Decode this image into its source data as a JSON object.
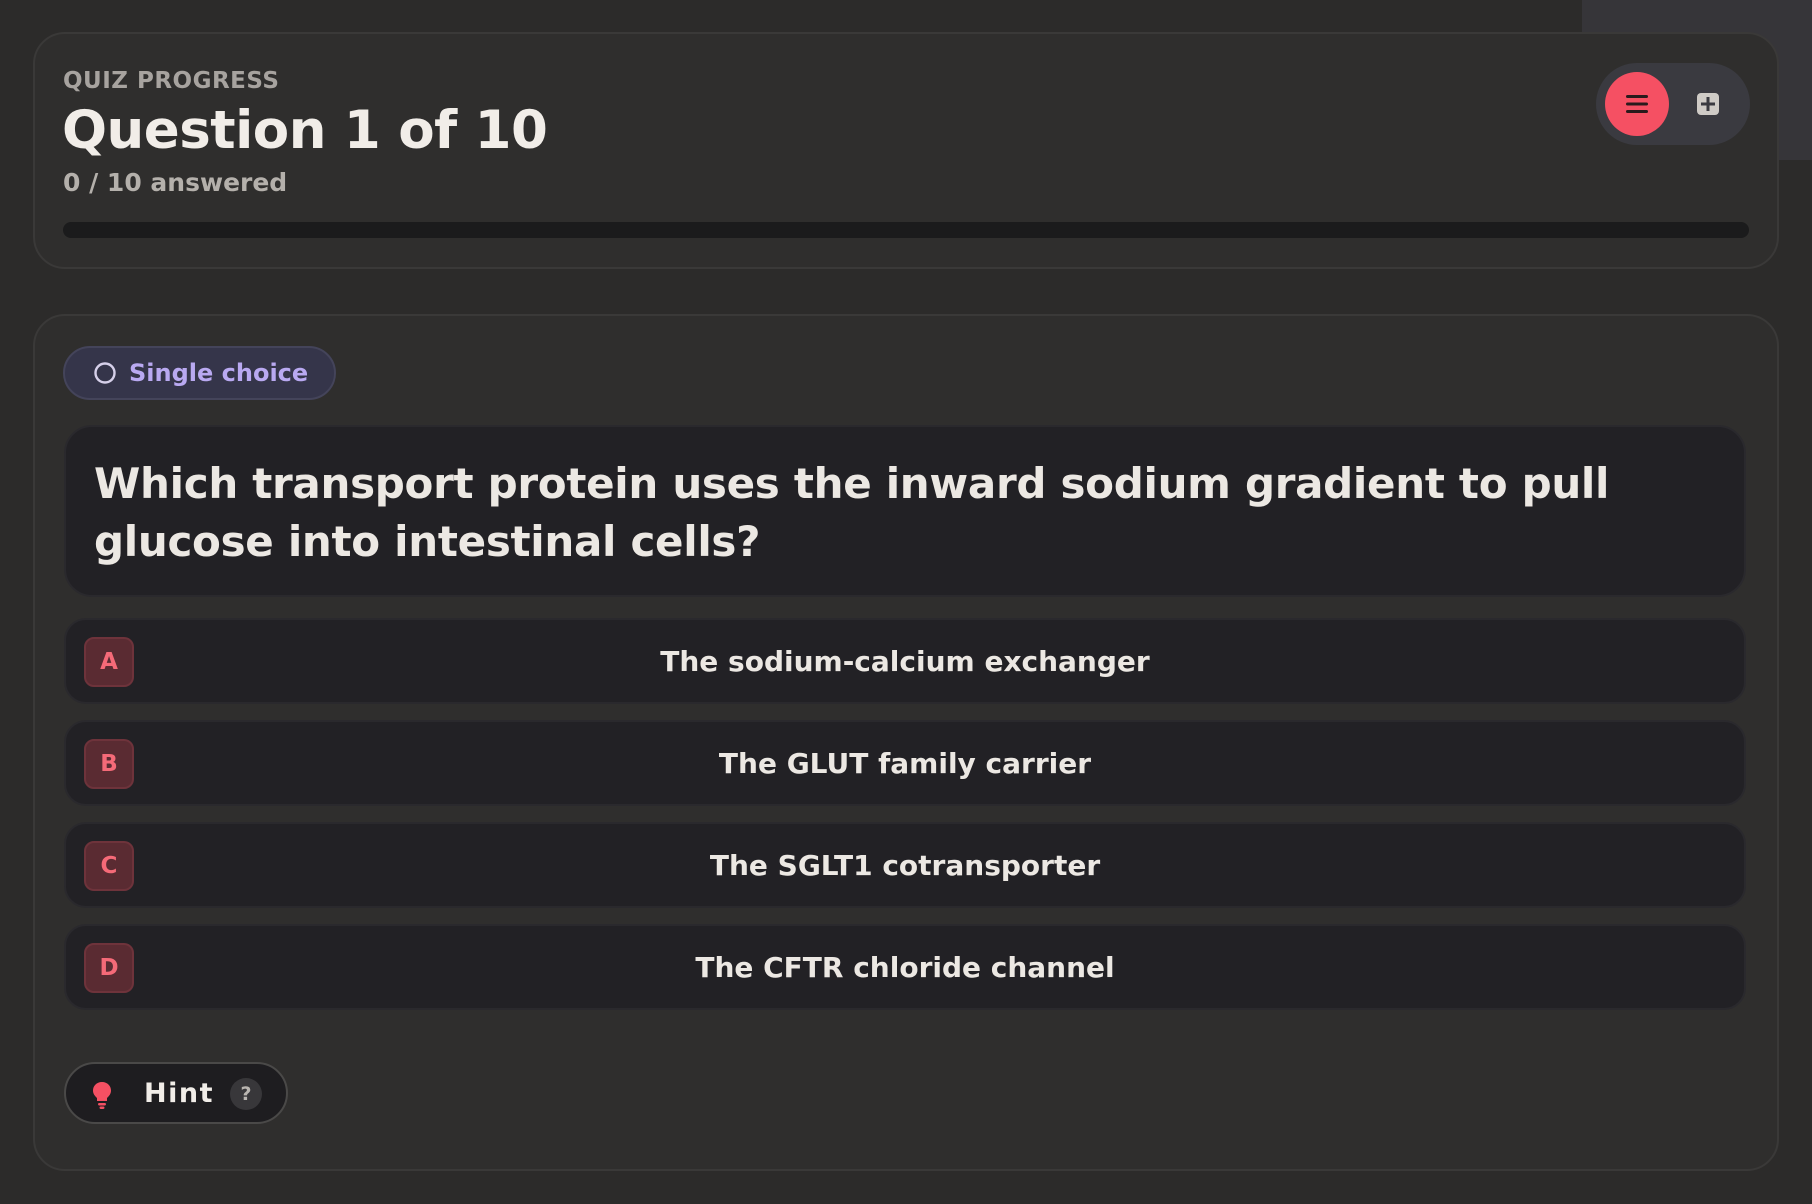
{
  "progress": {
    "eyebrow": "QUIZ PROGRESS",
    "title": "Question 1 of 10",
    "answered": "0 / 10 answered",
    "fraction": 0.0,
    "accent_color": "#f04e5e"
  },
  "toolbar": {
    "menu_icon": "menu-icon",
    "add_icon": "plus-square-icon"
  },
  "question": {
    "type_badge": "Single choice",
    "badge_icon": "radio-circle-icon",
    "text": "Which transport protein uses the inward sodium gradient to pull glucose into intestinal cells?",
    "options": [
      {
        "letter": "A",
        "text": "The sodium-calcium exchanger"
      },
      {
        "letter": "B",
        "text": "The GLUT family carrier"
      },
      {
        "letter": "C",
        "text": "The SGLT1 cotransporter"
      },
      {
        "letter": "D",
        "text": "The CFTR chloride channel"
      }
    ]
  },
  "hint": {
    "label": "Hint",
    "help": "?",
    "icon": "lightbulb-icon"
  }
}
